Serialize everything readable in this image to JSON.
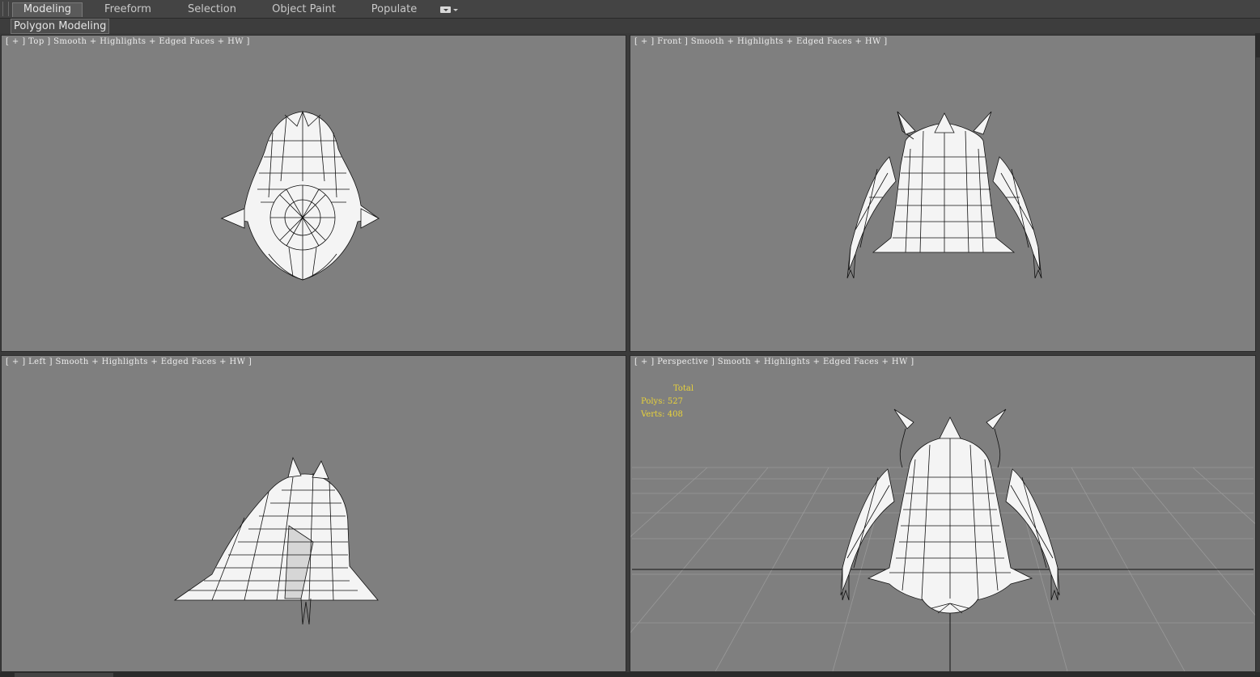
{
  "ribbon": {
    "tabs": [
      "Modeling",
      "Freeform",
      "Selection",
      "Object Paint",
      "Populate"
    ],
    "active_tab": "Modeling",
    "panel_label": "Polygon Modeling"
  },
  "viewports": {
    "top": {
      "label": "[ + ] Top ] Smooth + Highlights + Edged Faces + HW ]"
    },
    "front": {
      "label": "[ + ] Front ] Smooth + Highlights + Edged Faces + HW ]"
    },
    "left": {
      "label": "[ + ] Left ] Smooth + Highlights + Edged Faces + HW ]"
    },
    "perspective": {
      "label": "[ + ] Perspective ] Smooth + Highlights + Edged Faces + HW ]",
      "stats": {
        "total_label": "Total",
        "polys_label": "Polys:",
        "polys_value": "527",
        "verts_label": "Verts:",
        "verts_value": "408"
      }
    }
  },
  "colors": {
    "viewport_bg": "#7f7f7f",
    "stats_text": "#e8d23a",
    "mesh_fill": "#f4f4f4",
    "mesh_wire": "#111111"
  }
}
